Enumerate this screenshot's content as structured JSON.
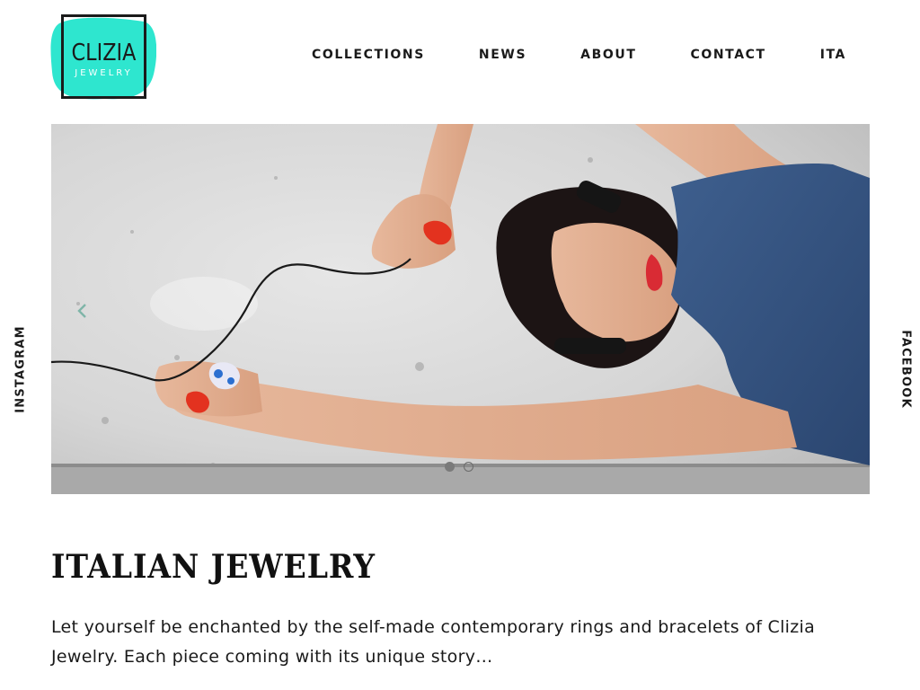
{
  "brand": {
    "name": "CLIZIA",
    "subtitle": "JEWELRY",
    "accent_color": "#2ee6cf"
  },
  "nav": {
    "items": [
      {
        "label": "COLLECTIONS"
      },
      {
        "label": "NEWS"
      },
      {
        "label": "ABOUT"
      },
      {
        "label": "CONTACT"
      },
      {
        "label": "ITA"
      }
    ]
  },
  "hero": {
    "prev_icon": "chevron-left-icon",
    "slides_total": 2,
    "active_slide": 1,
    "arrow_color": "#7fb5a8"
  },
  "social": {
    "left": "INSTAGRAM",
    "right": "FACEBOOK"
  },
  "content": {
    "title": "ITALIAN JEWELRY",
    "description": "Let yourself be enchanted by the self-made contemporary rings and bracelets of Clizia Jewelry. Each piece coming with its unique story…"
  }
}
